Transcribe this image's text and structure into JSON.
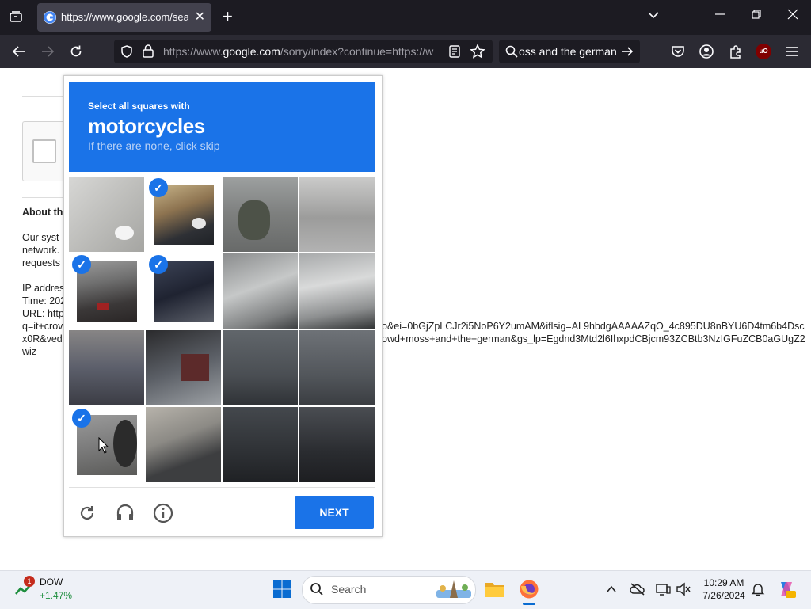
{
  "browser": {
    "tab_title": "https://www.google.com/sear",
    "url_domain": "https://www.",
    "url_host": "google.com",
    "url_rest": "/sorry/index?continue=https://w",
    "search_text": "oss and the german"
  },
  "page": {
    "about_heading": "About th",
    "para_lines": [
      "Our syst",
      "network.",
      "requests"
    ],
    "ip_label": "IP addres",
    "time_label": "Time: 202",
    "url_label": "URL: http",
    "url_line2": "q=it+crov",
    "url_line2_right": "o&ei=0bGjZpLCJr2i5NoP6Y2umAM&iflsig=AL9hbdgAAAAAZqO_4c895DU8nBYU6D4tm6b4Dsc",
    "url_line3": "x0R&ved",
    "url_line3_right": "owd+moss+and+the+german&gs_lp=Egdnd3Mtd2l6IhxpdCBjcm93ZCBtb3NzIGFuZCB0aGUgZ2",
    "url_line4": "wiz"
  },
  "captcha": {
    "instruction": "Select all squares with",
    "target": "motorcycles",
    "hint": "If there are none, click skip",
    "next_label": "NEXT"
  },
  "taskbar": {
    "stock_name": "DOW",
    "stock_change": "+1.47%",
    "stock_badge": "1",
    "search_label": "Search",
    "time": "10:29 AM",
    "date": "7/26/2024"
  }
}
